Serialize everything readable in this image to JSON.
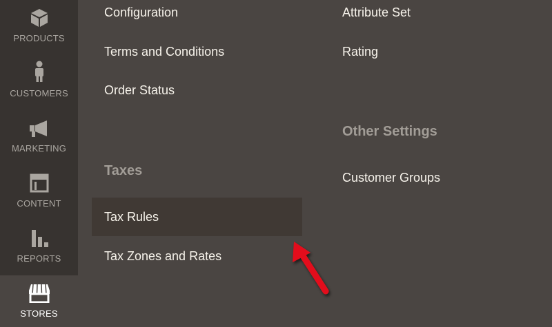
{
  "sidebar": {
    "items": [
      {
        "label": "PRODUCTS",
        "icon": "box-icon"
      },
      {
        "label": "CUSTOMERS",
        "icon": "person-icon"
      },
      {
        "label": "MARKETING",
        "icon": "megaphone-icon"
      },
      {
        "label": "CONTENT",
        "icon": "layout-icon"
      },
      {
        "label": "REPORTS",
        "icon": "bar-chart-icon"
      },
      {
        "label": "STORES",
        "icon": "storefront-icon",
        "active": true
      }
    ]
  },
  "menu": {
    "settings_column": {
      "links": [
        "Configuration",
        "Terms and Conditions",
        "Order Status"
      ]
    },
    "taxes": {
      "title": "Taxes",
      "links": [
        "Tax Rules",
        "Tax Zones and Rates"
      ],
      "highlighted": "Tax Rules"
    },
    "attributes_column": {
      "links": [
        "Attribute Set",
        "Rating"
      ]
    },
    "other_settings": {
      "title": "Other Settings",
      "links": [
        "Customer Groups"
      ]
    }
  },
  "colors": {
    "background": "#4a4542",
    "sidebar": "#373330",
    "link": "#f7f3eb",
    "section_title": "#a29d97",
    "highlight": "#403934",
    "arrow": "#e3101a"
  }
}
